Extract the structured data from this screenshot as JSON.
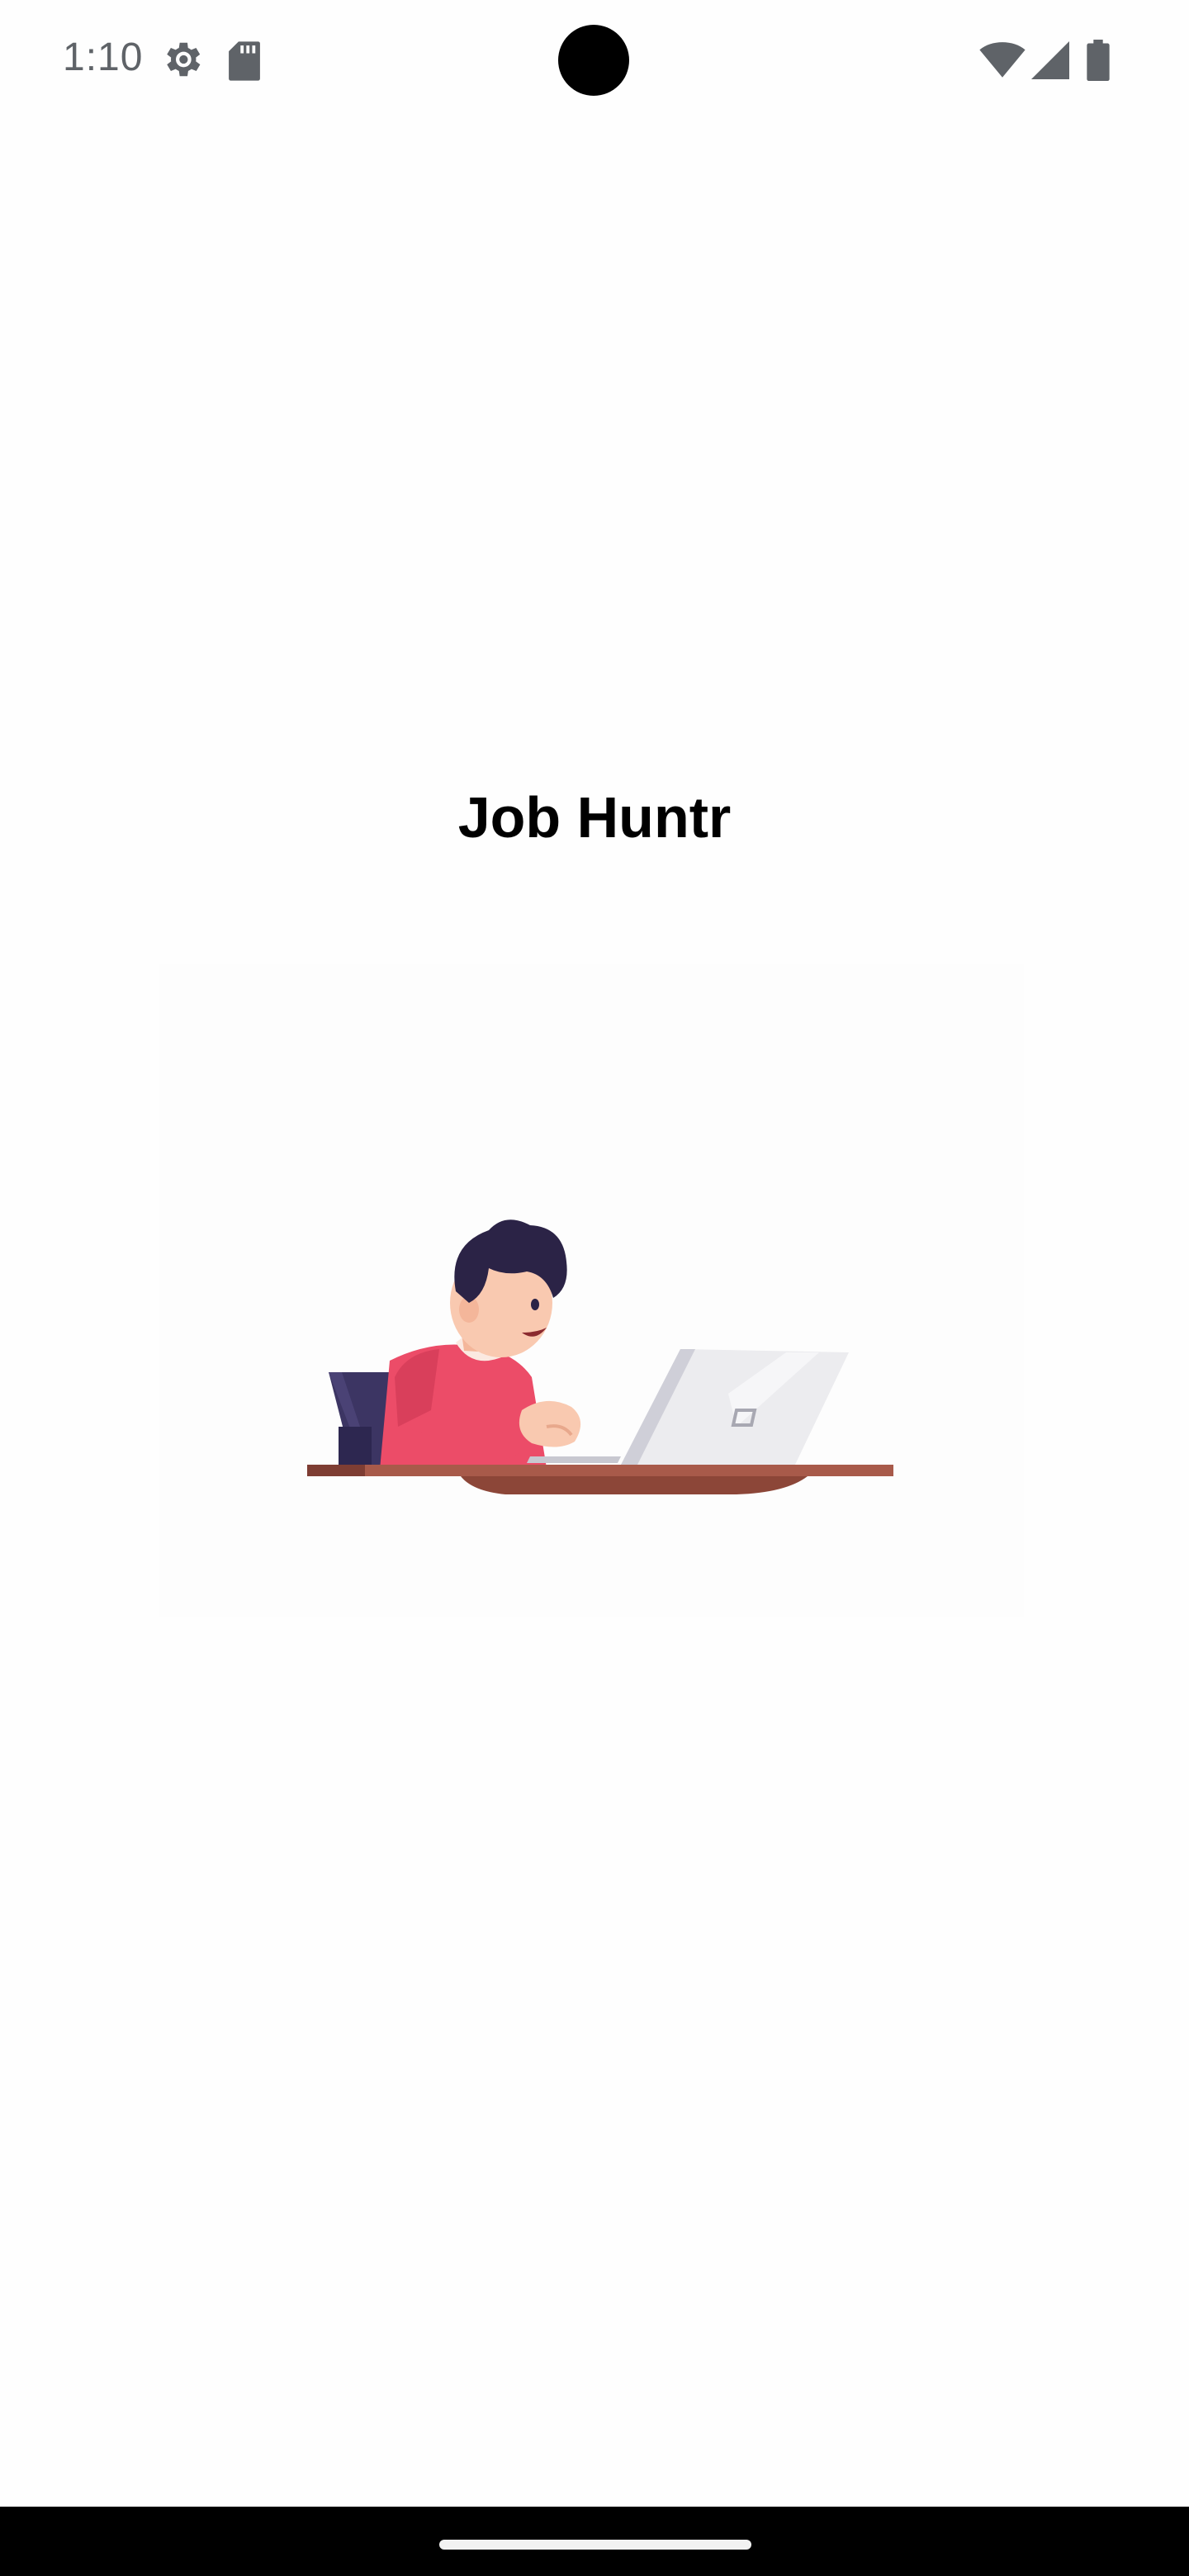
{
  "status_bar": {
    "time": "1:10",
    "icons": [
      "settings-gear-icon",
      "sd-card-icon",
      "wifi-icon",
      "cellular-signal-icon",
      "battery-icon"
    ]
  },
  "app": {
    "title": "Job Huntr"
  },
  "illustration": {
    "subject": "person-working-on-laptop-illustration"
  },
  "colors": {
    "background": "#fefefe",
    "title_text": "#000000",
    "status_text": "#5f6368",
    "shirt": "#ec4c68",
    "hair": "#2b2346",
    "desk": "#a85a4a",
    "laptop": "#e8e8ec",
    "nav_bar": "#000000"
  }
}
